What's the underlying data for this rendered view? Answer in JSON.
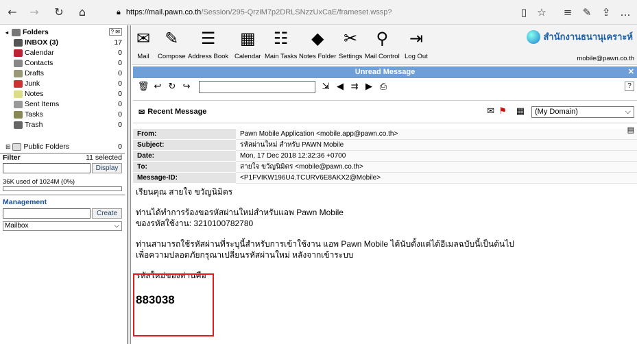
{
  "browser": {
    "url_domain": "https://mail.pawn.co.th",
    "url_path": "/Session/295-QrziM7p2DRLSNzzUxCaE/frameset.wssp?"
  },
  "folders": {
    "header": "Folders",
    "items": [
      {
        "label": "INBOX (3)",
        "count": "17",
        "color": "#555"
      },
      {
        "label": "Calendar",
        "count": "0",
        "color": "#b23"
      },
      {
        "label": "Contacts",
        "count": "0",
        "color": "#888"
      },
      {
        "label": "Drafts",
        "count": "0",
        "color": "#997"
      },
      {
        "label": "Junk",
        "count": "0",
        "color": "#c33"
      },
      {
        "label": "Notes",
        "count": "0",
        "color": "#dd8"
      },
      {
        "label": "Sent Items",
        "count": "0",
        "color": "#999"
      },
      {
        "label": "Tasks",
        "count": "0",
        "color": "#885"
      },
      {
        "label": "Trash",
        "count": "0",
        "color": "#666"
      }
    ],
    "public": {
      "label": "Public Folders",
      "count": "0"
    },
    "filter": {
      "label": "Filter",
      "selected": "11 selected",
      "display_label": "Display"
    },
    "quota": "36K used of 1024M  (0%)",
    "management": {
      "label": "Management",
      "create_label": "Create",
      "select_value": "Mailbox"
    }
  },
  "toolbar": {
    "items": [
      "Mail",
      "Compose",
      "Address Book",
      "Calendar",
      "Main Tasks",
      "Notes Folder",
      "Settings",
      "Mail Control",
      "Log Out"
    ],
    "brand": "สำนักงานธนานุเคราะห์",
    "email": "mobile@pawn.co.th"
  },
  "panel": {
    "title": "Unread Message",
    "recent": "Recent Message",
    "domain_select": "(My Domain)"
  },
  "headers": [
    {
      "k": "From:",
      "v": "Pawn Mobile Application <mobile.app@pawn.co.th>"
    },
    {
      "k": "Subject:",
      "v": "รหัสผ่านใหม่ สำหรับ PAWN Mobile"
    },
    {
      "k": "Date:",
      "v": "Mon, 17 Dec 2018 12:32:36 +0700"
    },
    {
      "k": "To:",
      "v": "สายใจ ขวัญนิมิตร <mobile@pawn.co.th>"
    },
    {
      "k": "Message-ID:",
      "v": "<P1FVIKW196U4.TCURV6E8AKX2@Mobile>"
    }
  ],
  "body": {
    "greeting": "เรียนคุณ สายใจ ขวัญนิมิตร",
    "line1": "ท่านได้ทำการร้องขอรหัสผ่านใหม่สำหรับแอพ Pawn Mobile",
    "line2": "ของรหัสใช้งาน: 3210100782780",
    "line3": "ท่านสามารถใช้รหัสผ่านที่ระบุนี้สำหรับการเข้าใช้งาน แอพ Pawn Mobile ได้นับตั้งแต่ได้อีเมลฉบับนี้เป็นต้นไป",
    "line4": "เพื่อความปลอดภัยกรุณาเปลี่ยนรหัสผ่านใหม่ หลังจากเข้าระบบ",
    "code_label": "รหัสใหม่ของท่านคือ",
    "code": "883038"
  }
}
